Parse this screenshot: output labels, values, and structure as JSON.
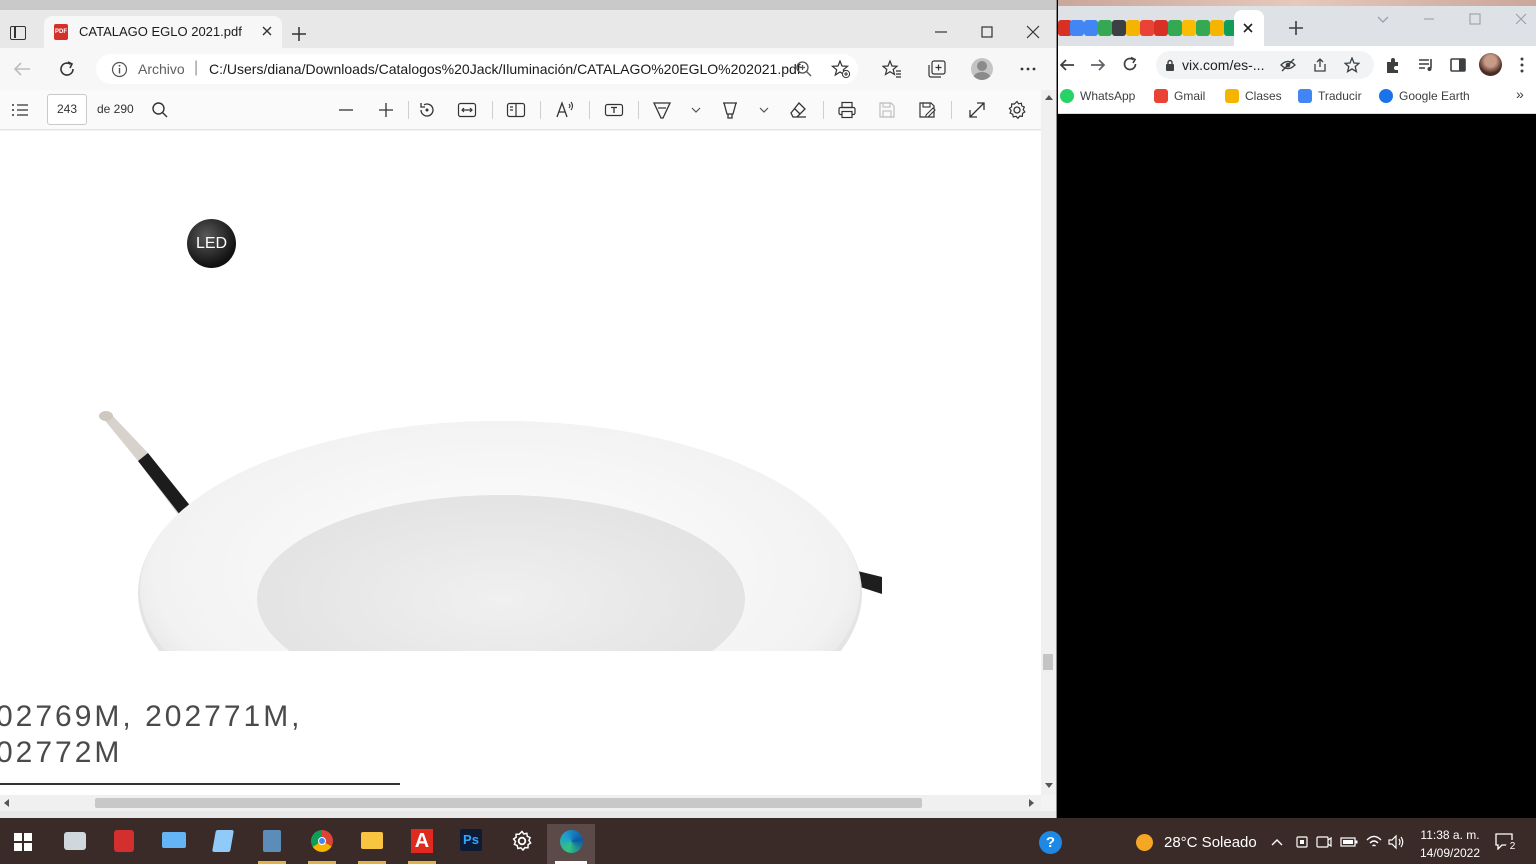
{
  "edge": {
    "tab_title": "CATALAGO EGLO 2021.pdf",
    "address_scheme": "Archivo",
    "address_sep": "|",
    "address_url": "C:/Users/diana/Downloads/Catalogos%20Jack/Iluminación/CATALAGO%20EGLO%202021.pdf",
    "page_current": "243",
    "page_total": "de 290",
    "pdf": {
      "badge": "LED",
      "codes_line1": "02769M, 202771M,",
      "codes_line2": "02772M"
    }
  },
  "chrome": {
    "url": "vix.com/es-...",
    "bookmarks": [
      {
        "label": "WhatsApp",
        "color": "#25d366"
      },
      {
        "label": "Gmail",
        "color": "#ea4335"
      },
      {
        "label": "Clases",
        "color": "#f4b400"
      },
      {
        "label": "Traducir",
        "color": "#4285f4"
      },
      {
        "label": "Google Earth",
        "color": "#1a73e8"
      }
    ],
    "more": "»"
  },
  "taskbar": {
    "weather": "28°C  Soleado",
    "time": "11:38 a. m.",
    "date": "14/09/2022",
    "notifications": "2",
    "ps_label": "Ps"
  }
}
